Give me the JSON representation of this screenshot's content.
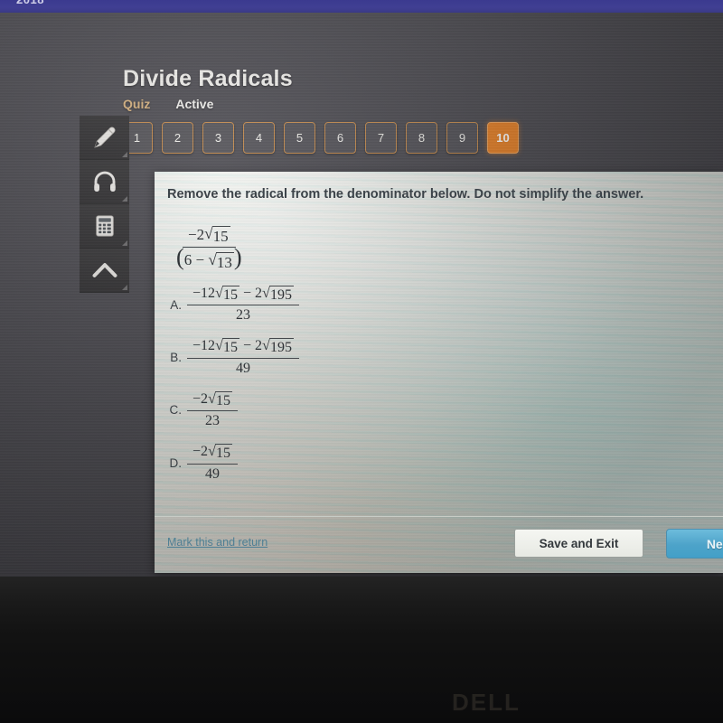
{
  "photo": {
    "top_strip_text": "2018",
    "laptop_brand": "DELL"
  },
  "header": {
    "title": "Divide Radicals",
    "subnav": {
      "kind_label": "Quiz",
      "status_label": "Active"
    }
  },
  "pager": {
    "items": [
      {
        "label": "1",
        "current": false
      },
      {
        "label": "2",
        "current": false
      },
      {
        "label": "3",
        "current": false
      },
      {
        "label": "4",
        "current": false
      },
      {
        "label": "5",
        "current": false
      },
      {
        "label": "6",
        "current": false
      },
      {
        "label": "7",
        "current": false
      },
      {
        "label": "8",
        "current": false
      },
      {
        "label": "9",
        "current": false
      },
      {
        "label": "10",
        "current": true
      }
    ],
    "current_label": "10"
  },
  "toolrail": {
    "items": [
      {
        "icon": "pencil-icon",
        "name": "pencil-tool"
      },
      {
        "icon": "headphones-icon",
        "name": "audio-tool"
      },
      {
        "icon": "calculator-icon",
        "name": "calculator-tool"
      },
      {
        "icon": "up-arrow-icon",
        "name": "scroll-up-tool"
      }
    ]
  },
  "question": {
    "prompt": "Remove the radical from the denominator below. Do not simplify the answer.",
    "expression": {
      "numerator": {
        "coefficient": "−2",
        "radicand": "15"
      },
      "denominator": {
        "open_paren": "(",
        "term": "6",
        "operator": "−",
        "radicand": "13",
        "close_paren": ")"
      }
    }
  },
  "choices": [
    {
      "letter": "A.",
      "numerator": {
        "first_coefficient": "−12",
        "first_radicand": "15",
        "operator": "−",
        "second_coefficient": "2",
        "second_radicand": "195"
      },
      "denominator": "23"
    },
    {
      "letter": "B.",
      "numerator": {
        "first_coefficient": "−12",
        "first_radicand": "15",
        "operator": "−",
        "second_coefficient": "2",
        "second_radicand": "195"
      },
      "denominator": "49"
    },
    {
      "letter": "C.",
      "numerator": {
        "first_coefficient": "−2",
        "first_radicand": "15",
        "operator": "",
        "second_coefficient": "",
        "second_radicand": ""
      },
      "denominator": "23"
    },
    {
      "letter": "D.",
      "numerator": {
        "first_coefficient": "−2",
        "first_radicand": "15",
        "operator": "",
        "second_coefficient": "",
        "second_radicand": ""
      },
      "denominator": "49"
    }
  ],
  "footer": {
    "mark_link": "Mark this and return",
    "save_button": "Save and Exit",
    "next_button": "Next"
  },
  "colors": {
    "accent_orange": "#e8832a",
    "next_blue": "#4da3c9",
    "link_blue": "#4f7f94",
    "chrome_gray": "#4a494f"
  }
}
